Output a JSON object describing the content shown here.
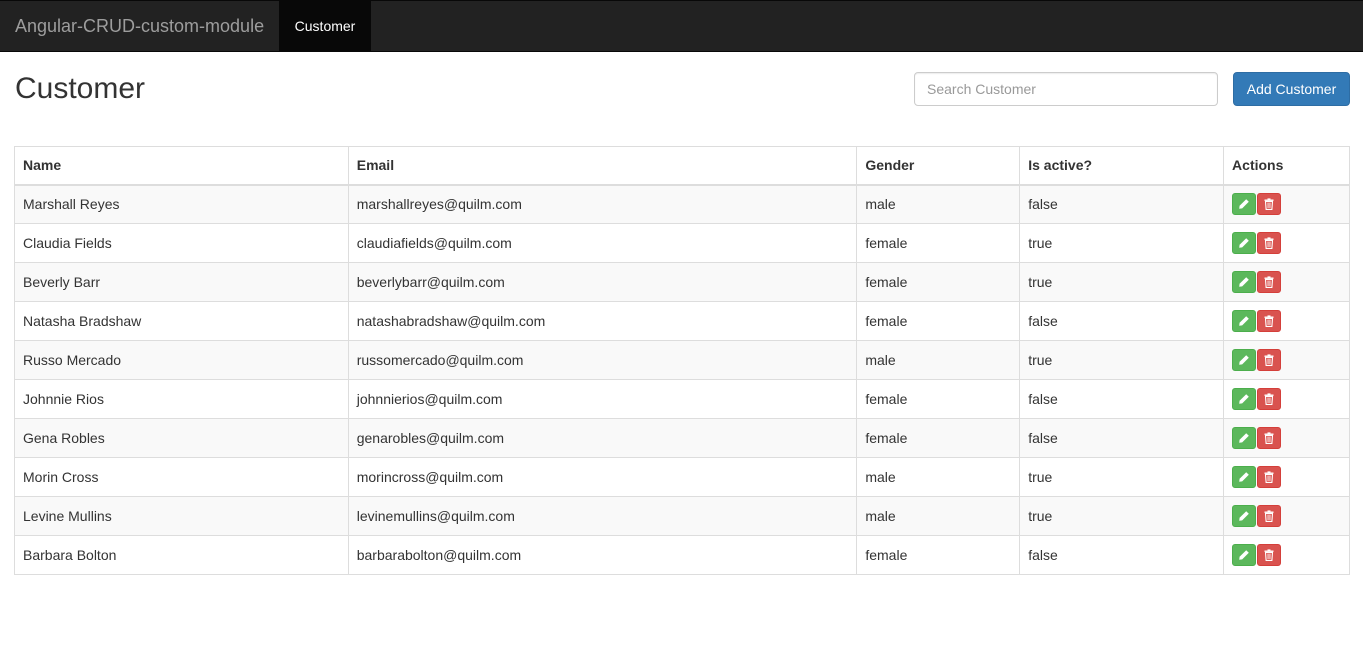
{
  "navbar": {
    "brand": "Angular-CRUD-custom-module",
    "active_item": "Customer"
  },
  "main": {
    "title": "Customer",
    "search": {
      "placeholder": "Search Customer",
      "value": ""
    },
    "add_button_label": "Add Customer"
  },
  "table": {
    "columns": [
      "Name",
      "Email",
      "Gender",
      "Is active?",
      "Actions"
    ],
    "rows": [
      {
        "name": "Marshall Reyes",
        "email": "marshallreyes@quilm.com",
        "gender": "male",
        "active": "false"
      },
      {
        "name": "Claudia Fields",
        "email": "claudiafields@quilm.com",
        "gender": "female",
        "active": "true"
      },
      {
        "name": "Beverly Barr",
        "email": "beverlybarr@quilm.com",
        "gender": "female",
        "active": "true"
      },
      {
        "name": "Natasha Bradshaw",
        "email": "natashabradshaw@quilm.com",
        "gender": "female",
        "active": "false"
      },
      {
        "name": "Russo Mercado",
        "email": "russomercado@quilm.com",
        "gender": "male",
        "active": "true"
      },
      {
        "name": "Johnnie Rios",
        "email": "johnnierios@quilm.com",
        "gender": "female",
        "active": "false"
      },
      {
        "name": "Gena Robles",
        "email": "genarobles@quilm.com",
        "gender": "female",
        "active": "false"
      },
      {
        "name": "Morin Cross",
        "email": "morincross@quilm.com",
        "gender": "male",
        "active": "true"
      },
      {
        "name": "Levine Mullins",
        "email": "levinemullins@quilm.com",
        "gender": "male",
        "active": "true"
      },
      {
        "name": "Barbara Bolton",
        "email": "barbarabolton@quilm.com",
        "gender": "female",
        "active": "false"
      }
    ],
    "row_actions": [
      "pencil-icon",
      "trash-icon"
    ]
  },
  "colors": {
    "navbar_bg": "#222222",
    "primary": "#337ab7",
    "success": "#5cb85c",
    "danger": "#d9534f"
  }
}
